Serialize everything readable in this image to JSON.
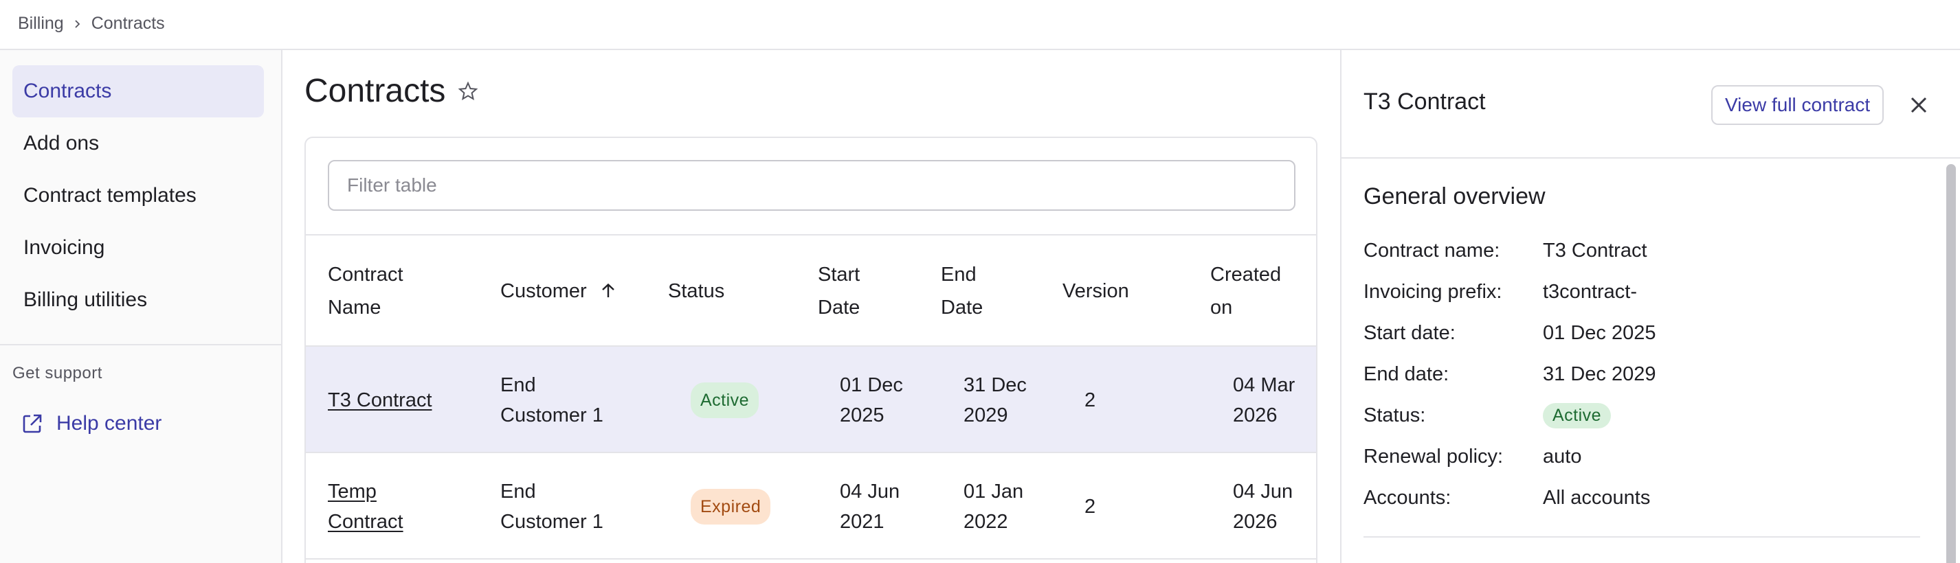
{
  "breadcrumb": {
    "items": [
      "Billing",
      "Contracts"
    ]
  },
  "sidebar": {
    "items": [
      {
        "label": "Contracts",
        "active": true
      },
      {
        "label": "Add ons"
      },
      {
        "label": "Contract templates"
      },
      {
        "label": "Invoicing"
      },
      {
        "label": "Billing utilities"
      }
    ],
    "support_label": "Get support",
    "help_center": "Help center"
  },
  "main": {
    "title": "Contracts",
    "filter_placeholder": "Filter table",
    "columns": [
      {
        "line1": "Contract",
        "line2": "Name"
      },
      {
        "line1": "Customer",
        "line2": ""
      },
      {
        "line1": "Status",
        "line2": ""
      },
      {
        "line1": "Start",
        "line2": "Date"
      },
      {
        "line1": "End",
        "line2": "Date"
      },
      {
        "line1": "Version",
        "line2": ""
      },
      {
        "line1": "Created",
        "line2": "on"
      }
    ],
    "rows": [
      {
        "name_l1": "T3 Contract",
        "name_l2": "",
        "customer_l1": "End",
        "customer_l2": "Customer 1",
        "status": "Active",
        "start_l1": "01 Dec",
        "start_l2": "2025",
        "end_l1": "31 Dec",
        "end_l2": "2029",
        "version": "2",
        "created_l1": "04 Mar",
        "created_l2": "2026"
      },
      {
        "name_l1": "Temp",
        "name_l2": "Contract",
        "customer_l1": "End",
        "customer_l2": "Customer 1",
        "status": "Expired",
        "start_l1": "04 Jun",
        "start_l2": "2021",
        "end_l1": "01 Jan",
        "end_l2": "2022",
        "version": "2",
        "created_l1": "04 Jun",
        "created_l2": "2026"
      }
    ]
  },
  "panel": {
    "title": "T3 Contract",
    "view_button": "View full contract",
    "overview_title": "General overview",
    "fields": [
      {
        "label": "Contract name:",
        "value": "T3 Contract"
      },
      {
        "label": "Invoicing prefix:",
        "value": "t3contract-"
      },
      {
        "label": "Start date:",
        "value": "01 Dec 2025"
      },
      {
        "label": "End date:",
        "value": "31 Dec 2029"
      },
      {
        "label": "Status:",
        "value": "Active"
      },
      {
        "label": "Renewal policy:",
        "value": "auto"
      },
      {
        "label": "Accounts:",
        "value": "All accounts"
      }
    ]
  },
  "colors": {
    "accent": "#3b3ba6",
    "active_nav_bg": "#e9e9f7",
    "selected_row_bg": "#ececf8",
    "badge_active_bg": "#d9f0dd",
    "badge_active_text": "#1e6b32",
    "badge_expired_bg": "#fde3cf",
    "badge_expired_text": "#a24b12"
  },
  "icons": {
    "breadcrumb_separator": "chevron-right-icon",
    "help_center": "external-link-icon",
    "favorite": "star-icon",
    "sort": "arrow-up-icon",
    "close": "close-icon"
  }
}
